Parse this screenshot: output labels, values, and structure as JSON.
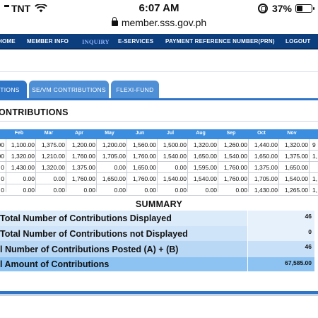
{
  "status_bar": {
    "carrier": "TNT",
    "time": "6:07 AM",
    "battery": "37%",
    "battery_level": 0.37
  },
  "browser": {
    "url": "member.sss.gov.ph"
  },
  "nav": {
    "items": [
      "HOME",
      "MEMBER INFO",
      "INQUIRY",
      "E-SERVICES",
      "PAYMENT REFERENCE NUMBER(PRN)",
      "LOGOUT"
    ],
    "active": "INQUIRY"
  },
  "tabs": [
    "TIONS",
    "SE/VM CONTRIBUTIONS",
    "FLEXI-FUND"
  ],
  "panel": {
    "title": "ONTRIBUTIONS"
  },
  "table": {
    "headers": [
      "Feb",
      "Mar",
      "Apr",
      "May",
      "Jun",
      "Jul",
      "Aug",
      "Sep",
      "Oct",
      "Nov"
    ],
    "rows": [
      [
        "00",
        "1,100.00",
        "1,375.00",
        "1,200.00",
        "1,200.00",
        "1,560.00",
        "1,500.00",
        "1,320.00",
        "1,260.00",
        "1,440.00",
        "1,320.00",
        "9"
      ],
      [
        "00",
        "1,320.00",
        "1,210.00",
        "1,760.00",
        "1,705.00",
        "1,760.00",
        "1,540.00",
        "1,650.00",
        "1,540.00",
        "1,650.00",
        "1,375.00",
        "1,"
      ],
      [
        "0",
        "1,430.00",
        "1,320.00",
        "1,375.00",
        "0.00",
        "1,650.00",
        "0.00",
        "1,595.00",
        "1,760.00",
        "1,375.00",
        "1,650.00",
        ""
      ],
      [
        "0",
        "0.00",
        "0.00",
        "1,760.00",
        "1,650.00",
        "1,760.00",
        "1,540.00",
        "1,540.00",
        "1,760.00",
        "1,705.00",
        "1,540.00",
        "1,"
      ],
      [
        "0",
        "0.00",
        "0.00",
        "0.00",
        "0.00",
        "0.00",
        "0.00",
        "0.00",
        "0.00",
        "1,430.00",
        "1,265.00",
        "1,"
      ]
    ]
  },
  "summary": {
    "title": "SUMMARY",
    "rows": [
      {
        "label": "Total Number of Contributions Displayed",
        "value": "46"
      },
      {
        "label": "Total Number of Contributions not Displayed",
        "value": "0"
      },
      {
        "label": "l Number of Contributions Posted (A) + (B)",
        "value": "46"
      },
      {
        "label": "l Amount of Contributions",
        "value": "67,585.00"
      }
    ]
  },
  "colors": {
    "nav_bg": "#0c3d7c",
    "tab_bg": "#4f8fd6",
    "table_header": "#3b8de0",
    "summary_light": "#dcebfa",
    "summary_mid": "#b9d8f6",
    "summary_total": "#8cc3f2"
  },
  "icons": [
    "signal-icon",
    "wifi-icon",
    "rotation-lock-icon",
    "battery-icon",
    "lock-icon"
  ]
}
